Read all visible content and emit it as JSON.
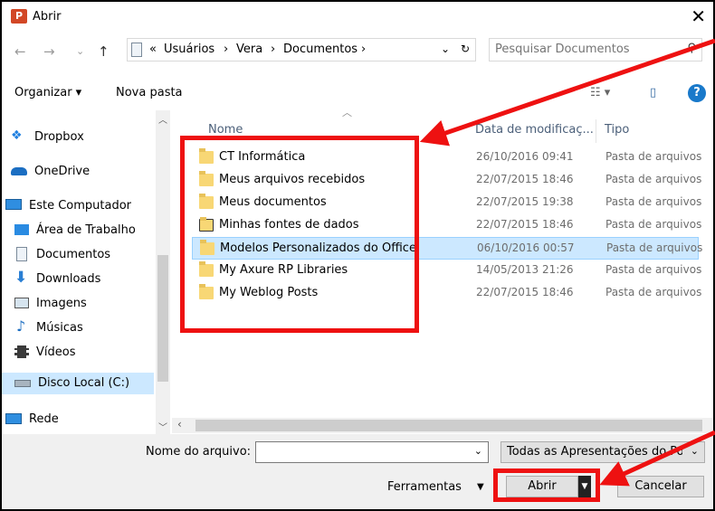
{
  "window": {
    "title": "Abrir",
    "app_icon": "P",
    "close": "✕"
  },
  "navigation": {
    "back": "←",
    "forward": "→",
    "recent": "⌄",
    "up": "↑"
  },
  "address": {
    "overflow": "«",
    "crumbs": [
      "Usuários",
      "Vera",
      "Documentos"
    ],
    "separator": "›",
    "dropdown": "⌄",
    "refresh": "↻"
  },
  "search": {
    "placeholder": "Pesquisar Documentos",
    "icon": "⚲"
  },
  "toolbar": {
    "organize": "Organizar ▾",
    "new_folder": "Nova pasta",
    "view": "☷ ▾",
    "pane": "▯",
    "help": "?"
  },
  "sidebar": {
    "items": [
      {
        "label": "Dropbox",
        "icon": "dropbox-icon"
      },
      {
        "label": "OneDrive",
        "icon": "onedrive-icon"
      },
      {
        "label": "Este Computador",
        "icon": "computer-icon"
      },
      {
        "label": "Área de Trabalho",
        "icon": "desktop-icon"
      },
      {
        "label": "Documentos",
        "icon": "documents-icon"
      },
      {
        "label": "Downloads",
        "icon": "download-icon"
      },
      {
        "label": "Imagens",
        "icon": "pictures-icon"
      },
      {
        "label": "Músicas",
        "icon": "music-icon"
      },
      {
        "label": "Vídeos",
        "icon": "video-icon"
      },
      {
        "label": "Disco Local (C:)",
        "icon": "drive-icon",
        "selected": true
      },
      {
        "label": "Rede",
        "icon": "network-icon"
      }
    ]
  },
  "columns": {
    "name": "Nome",
    "date": "Data de modificaç...",
    "type": "Tipo",
    "sort_arrow": "︿"
  },
  "files": [
    {
      "name": "CT Informática",
      "date": "26/10/2016 09:41",
      "type": "Pasta de arquivos"
    },
    {
      "name": "Meus arquivos recebidos",
      "date": "22/07/2015 18:46",
      "type": "Pasta de arquivos"
    },
    {
      "name": "Meus documentos",
      "date": "22/07/2015 19:38",
      "type": "Pasta de arquivos"
    },
    {
      "name": "Minhas fontes de dados",
      "date": "22/07/2015 18:46",
      "type": "Pasta de arquivos"
    },
    {
      "name": "Modelos Personalizados do Office",
      "date": "06/10/2016 00:57",
      "type": "Pasta de arquivos",
      "selected": true
    },
    {
      "name": "My Axure RP Libraries",
      "date": "14/05/2013 21:26",
      "type": "Pasta de arquivos"
    },
    {
      "name": "My Weblog Posts",
      "date": "22/07/2015 18:46",
      "type": "Pasta de arquivos"
    }
  ],
  "bottom": {
    "filename_label": "Nome do arquivo:",
    "filename_value": "",
    "filter": "Todas as Apresentações do Pov",
    "tools": "Ferramentas",
    "tools_arrow": "▼",
    "open": "Abrir",
    "cancel": "Cancelar"
  },
  "colors": {
    "annotation": "#ee1111",
    "selection": "#cce8ff",
    "folder": "#f8d775",
    "help": "#1979ca"
  }
}
